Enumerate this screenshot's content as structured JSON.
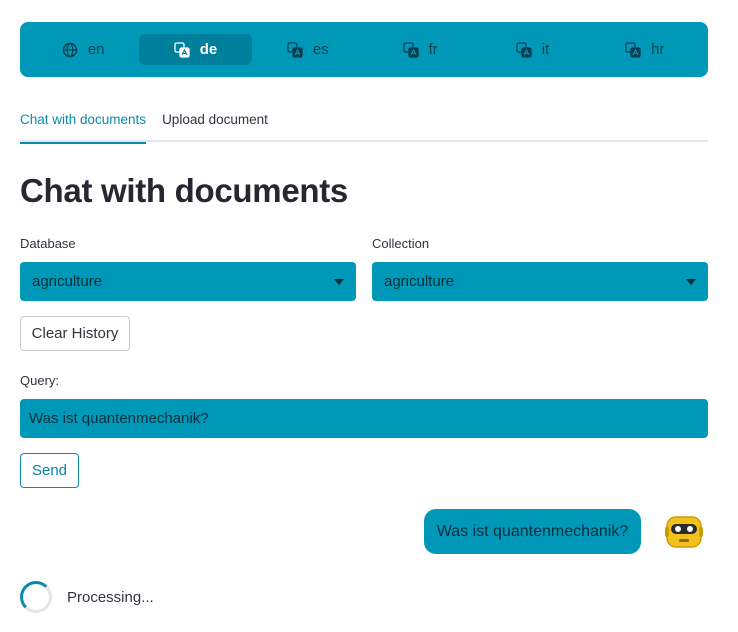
{
  "languages": [
    {
      "code": "en",
      "icon": "globe-icon",
      "active": false
    },
    {
      "code": "de",
      "icon": "translate-icon",
      "active": true
    },
    {
      "code": "es",
      "icon": "translate-icon",
      "active": false
    },
    {
      "code": "fr",
      "icon": "translate-icon",
      "active": false
    },
    {
      "code": "it",
      "icon": "translate-icon",
      "active": false
    },
    {
      "code": "hr",
      "icon": "translate-icon",
      "active": false
    }
  ],
  "tabs": [
    {
      "label": "Chat with documents",
      "active": true
    },
    {
      "label": "Upload document",
      "active": false
    }
  ],
  "page": {
    "title": "Chat with documents"
  },
  "database": {
    "label": "Database",
    "value": "agriculture"
  },
  "collection": {
    "label": "Collection",
    "value": "agriculture"
  },
  "buttons": {
    "clear_history": "Clear History",
    "send": "Send"
  },
  "query": {
    "label": "Query:",
    "value": "Was ist quantenmechanik?"
  },
  "chat": {
    "message": "Was ist quantenmechanik?",
    "avatar_icon": "robot-icon"
  },
  "status": {
    "text": "Processing..."
  },
  "colors": {
    "accent": "#0098b8",
    "accent_dark": "#007f9c",
    "link": "#0b8aab"
  }
}
